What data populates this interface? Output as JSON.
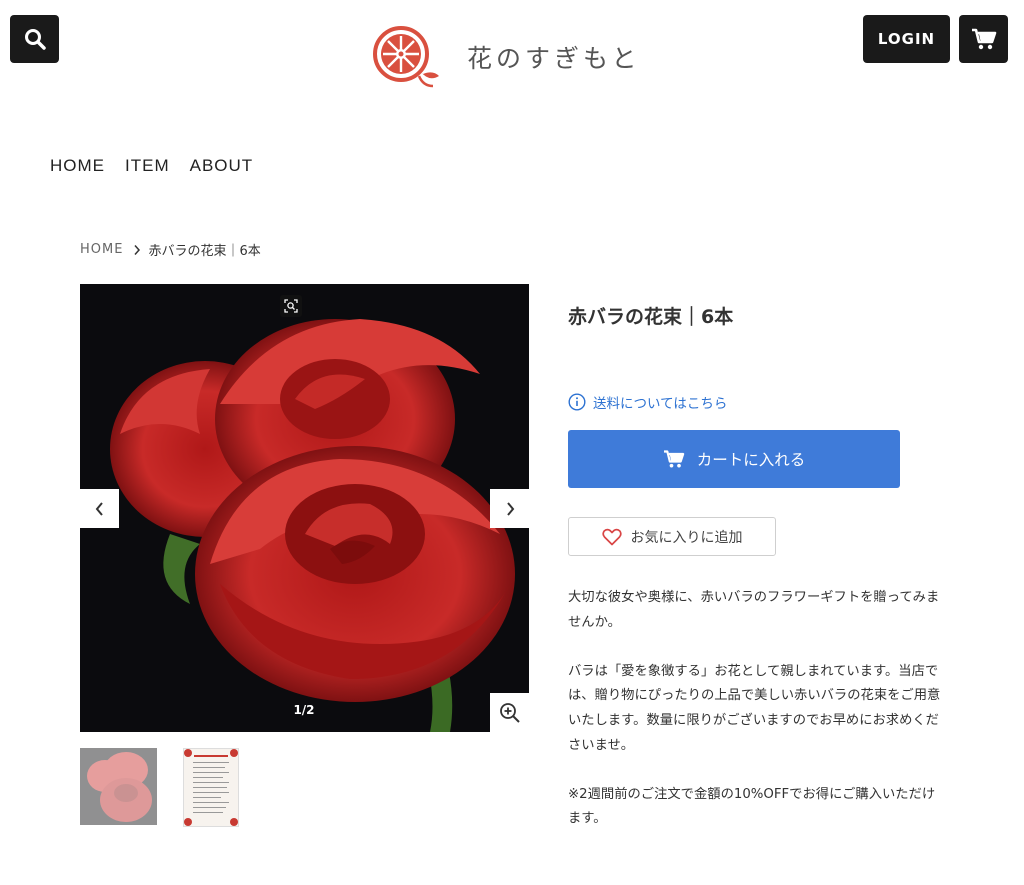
{
  "header": {
    "logo_text": "花のすぎもと",
    "login_label": "LOGIN",
    "icons": {
      "search": "search-icon",
      "cart": "cart-icon",
      "logo": "flower-logo-icon"
    }
  },
  "nav": {
    "items": [
      "HOME",
      "ITEM",
      "ABOUT"
    ]
  },
  "breadcrumb": {
    "home": "HOME",
    "current": "赤バラの花束｜6本"
  },
  "gallery": {
    "counter": "1/2",
    "image_subject": "red roses on black background",
    "thumbnails": [
      "red roses photo",
      "care instructions card"
    ]
  },
  "product": {
    "title": "赤バラの花束｜6本",
    "shipping_link": "送料についてはこちら",
    "add_to_cart": "カートに入れる",
    "favorite": "お気に入りに追加",
    "description": [
      "大切な彼女や奥様に、赤いバラのフラワーギフトを贈ってみませんか。",
      "バラは「愛を象徴する」お花として親しまれています。当店では、贈り物にぴったりの上品で美しい赤いバラの花束をご用意いたします。数量に限りがございますのでお早めにお求めくださいませ。",
      "※2週間前のご注文で金額の10%OFFでお得にご購入いただけます。"
    ]
  },
  "colors": {
    "accent": "#3f7bd9",
    "link": "#2d72d2",
    "logo": "#d9503f",
    "heart": "#d94545",
    "dark_button": "#1a1a1a"
  }
}
